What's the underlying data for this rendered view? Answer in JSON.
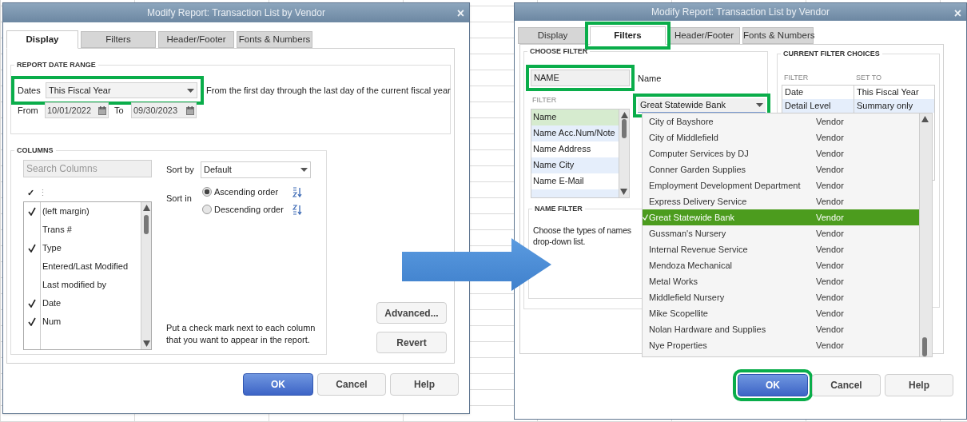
{
  "left_dialog": {
    "title": "Modify Report: Transaction List by Vendor",
    "close": "×",
    "tabs": [
      {
        "label": "Display",
        "selected": true,
        "highlighted": false
      },
      {
        "label": "Filters",
        "selected": false,
        "highlighted": false
      },
      {
        "label": "Header/Footer",
        "selected": false,
        "highlighted": false
      },
      {
        "label": "Fonts & Numbers",
        "selected": false,
        "highlighted": false
      }
    ],
    "date_range": {
      "heading": "REPORT DATE RANGE",
      "dates_label": "Dates",
      "dates_value": "This Fiscal Year",
      "highlighted": true,
      "description": "From the first day through the last day of the current fiscal year",
      "from_label": "From",
      "from_value": "10/01/2022",
      "to_label": "To",
      "to_value": "09/30/2023"
    },
    "columns": {
      "heading": "COLUMNS",
      "search_placeholder": "Search Columns",
      "header_mark": "✓",
      "header_divider": "⋮",
      "items": [
        {
          "label": "(left margin)",
          "checked": true
        },
        {
          "label": "Trans #",
          "checked": false
        },
        {
          "label": "Type",
          "checked": true
        },
        {
          "label": "Entered/Last Modified",
          "checked": false
        },
        {
          "label": "Last modified by",
          "checked": false
        },
        {
          "label": "Date",
          "checked": true
        },
        {
          "label": "Num",
          "checked": true
        }
      ],
      "sort_by_label": "Sort by",
      "sort_by_value": "Default",
      "sort_in_label": "Sort in",
      "sort_options": [
        {
          "label": "Ascending order",
          "kind": "ascending",
          "selected": true
        },
        {
          "label": "Descending order",
          "kind": "descending",
          "selected": false
        }
      ],
      "hint": "Put a check mark next to each column that you want to appear in the report."
    },
    "side_buttons": [
      "Advanced...",
      "Revert"
    ],
    "buttons": [
      {
        "label": "OK",
        "kind": "primary",
        "highlighted": false
      },
      {
        "label": "Cancel",
        "kind": "normal",
        "highlighted": false
      },
      {
        "label": "Help",
        "kind": "normal",
        "highlighted": false
      }
    ]
  },
  "right_dialog": {
    "title": "Modify Report: Transaction List by Vendor",
    "close": "×",
    "tabs": [
      {
        "label": "Display",
        "selected": false,
        "highlighted": false
      },
      {
        "label": "Filters",
        "selected": true,
        "highlighted": true
      },
      {
        "label": "Header/Footer",
        "selected": false,
        "highlighted": false
      },
      {
        "label": "Fonts & Numbers",
        "selected": false,
        "highlighted": false
      }
    ],
    "choose_filter": {
      "heading": "CHOOSE FILTER",
      "search_value": "NAME",
      "search_highlighted": true,
      "filter_label": "FILTER",
      "filters": [
        {
          "label": "Name",
          "selected": true
        },
        {
          "label": "Name Acc.Num/Note",
          "selected": false
        },
        {
          "label": "Name Address",
          "selected": false
        },
        {
          "label": "Name City",
          "selected": false
        },
        {
          "label": "Name E-Mail",
          "selected": false
        }
      ],
      "name_label": "Name",
      "name_value": "Great Statewide Bank",
      "name_highlighted": true,
      "name_filter_heading": "NAME FILTER",
      "name_filter_lines": [
        "Choose the types of names",
        "drop-down list."
      ]
    },
    "current_filters": {
      "heading": "CURRENT FILTER CHOICES",
      "columns": [
        "FILTER",
        "SET TO"
      ],
      "rows": [
        [
          "Date",
          "This Fiscal Year"
        ],
        [
          "Detail Level",
          "Summary only"
        ]
      ]
    },
    "name_dropdown": [
      {
        "name": "City of Bayshore",
        "type": "Vendor",
        "selected": false
      },
      {
        "name": "City of Middlefield",
        "type": "Vendor",
        "selected": false
      },
      {
        "name": "Computer Services by DJ",
        "type": "Vendor",
        "selected": false
      },
      {
        "name": "Conner Garden Supplies",
        "type": "Vendor",
        "selected": false
      },
      {
        "name": "Employment Development Department",
        "type": "Vendor",
        "selected": false
      },
      {
        "name": "Express Delivery Service",
        "type": "Vendor",
        "selected": false
      },
      {
        "name": "Great Statewide Bank",
        "type": "Vendor",
        "selected": true
      },
      {
        "name": "Gussman's Nursery",
        "type": "Vendor",
        "selected": false
      },
      {
        "name": "Internal Revenue Service",
        "type": "Vendor",
        "selected": false
      },
      {
        "name": "Mendoza Mechanical",
        "type": "Vendor",
        "selected": false
      },
      {
        "name": "Metal Works",
        "type": "Vendor",
        "selected": false
      },
      {
        "name": "Middlefield Nursery",
        "type": "Vendor",
        "selected": false
      },
      {
        "name": "Mike Scopellite",
        "type": "Vendor",
        "selected": false
      },
      {
        "name": "Nolan Hardware and Supplies",
        "type": "Vendor",
        "selected": false
      },
      {
        "name": "Nye Properties",
        "type": "Vendor",
        "selected": false
      }
    ],
    "buttons": [
      {
        "label": "OK",
        "kind": "primary",
        "highlighted": true
      },
      {
        "label": "Cancel",
        "kind": "normal",
        "highlighted": false
      },
      {
        "label": "Help",
        "kind": "normal",
        "highlighted": false
      }
    ]
  }
}
